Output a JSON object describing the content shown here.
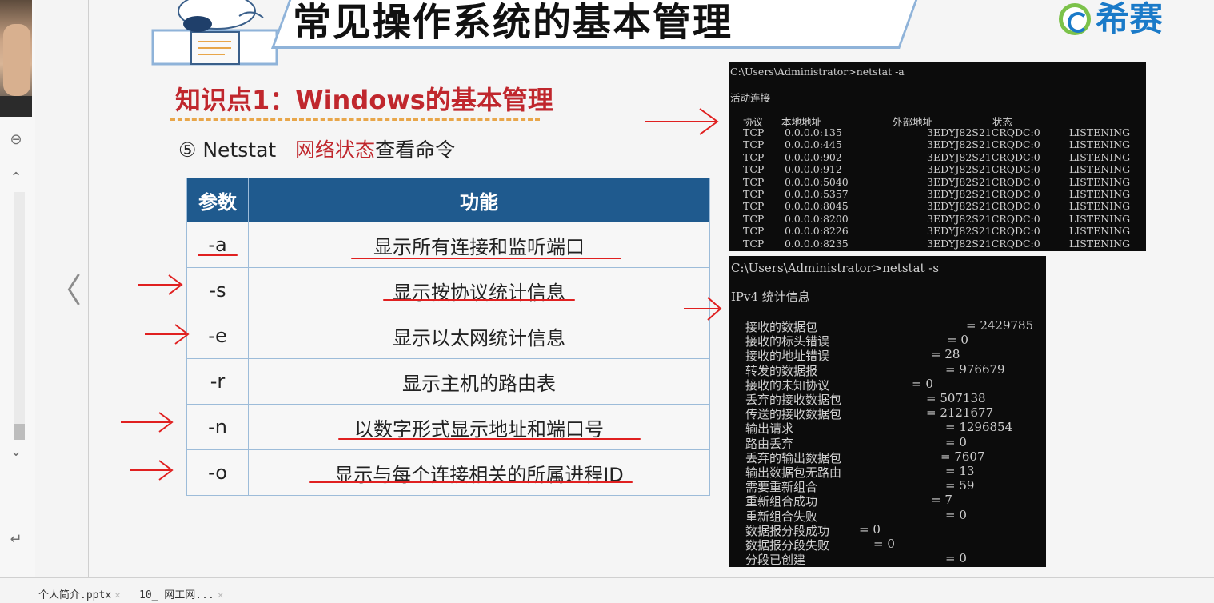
{
  "slide": {
    "title": "常见操作系统的基本管理",
    "brand": {
      "name": "希赛"
    },
    "topic_heading": "知识点1：Windows的基本管理",
    "subtitle": {
      "prefix": "⑤ Netstat",
      "highlight": "网络状态",
      "suffix": "查看命令"
    },
    "table": {
      "headers": [
        "参数",
        "功能"
      ],
      "rows": [
        {
          "param": "-a",
          "function": "显示所有连接和监听端口"
        },
        {
          "param": "-s",
          "function": "显示按协议统计信息"
        },
        {
          "param": "-e",
          "function": "显示以太网统计信息"
        },
        {
          "param": "-r",
          "function": "显示主机的路由表"
        },
        {
          "param": "-n",
          "function": "以数字形式显示地址和端口号"
        },
        {
          "param": "-o",
          "function": "显示与每个连接相关的所属进程ID"
        }
      ]
    }
  },
  "terminal_a": {
    "prompt": "C:\\Users\\Administrator>netstat -a",
    "section": "活动连接",
    "columns": [
      "协议",
      "本地地址",
      "外部地址",
      "状态"
    ],
    "rows": [
      [
        "TCP",
        "0.0.0.0:135",
        "3EDYJ82S21CRQDC:0",
        "LISTENING"
      ],
      [
        "TCP",
        "0.0.0.0:445",
        "3EDYJ82S21CRQDC:0",
        "LISTENING"
      ],
      [
        "TCP",
        "0.0.0.0:902",
        "3EDYJ82S21CRQDC:0",
        "LISTENING"
      ],
      [
        "TCP",
        "0.0.0.0:912",
        "3EDYJ82S21CRQDC:0",
        "LISTENING"
      ],
      [
        "TCP",
        "0.0.0.0:5040",
        "3EDYJ82S21CRQDC:0",
        "LISTENING"
      ],
      [
        "TCP",
        "0.0.0.0:5357",
        "3EDYJ82S21CRQDC:0",
        "LISTENING"
      ],
      [
        "TCP",
        "0.0.0.0:8045",
        "3EDYJ82S21CRQDC:0",
        "LISTENING"
      ],
      [
        "TCP",
        "0.0.0.0:8200",
        "3EDYJ82S21CRQDC:0",
        "LISTENING"
      ],
      [
        "TCP",
        "0.0.0.0:8226",
        "3EDYJ82S21CRQDC:0",
        "LISTENING"
      ],
      [
        "TCP",
        "0.0.0.0:8235",
        "3EDYJ82S21CRQDC:0",
        "LISTENING"
      ]
    ]
  },
  "terminal_s": {
    "prompt": "C:\\Users\\Administrator>netstat -s",
    "section": "IPv4 统计信息",
    "stats": [
      [
        "接收的数据包",
        "= 2429785"
      ],
      [
        "接收的标头错误",
        "= 0"
      ],
      [
        "接收的地址错误",
        "= 28"
      ],
      [
        "转发的数据报",
        "= 976679"
      ],
      [
        "接收的未知协议",
        "= 0"
      ],
      [
        "丢弃的接收数据包",
        "= 507138"
      ],
      [
        "传送的接收数据包",
        "= 2121677"
      ],
      [
        "输出请求",
        "= 1296854"
      ],
      [
        "路由丢弃",
        "= 0"
      ],
      [
        "丢弃的输出数据包",
        "= 7607"
      ],
      [
        "输出数据包无路由",
        "= 13"
      ],
      [
        "需要重新组合",
        "= 59"
      ],
      [
        "重新组合成功",
        "= 7"
      ],
      [
        "重新组合失败",
        "= 0"
      ],
      [
        "数据报分段成功",
        "= 0"
      ],
      [
        "数据报分段失败",
        "= 0"
      ],
      [
        "分段已创建",
        "= 0"
      ]
    ]
  },
  "bottom_tabs": [
    {
      "label": "个人简介.pptx"
    },
    {
      "label": "10_ 网工网..."
    }
  ],
  "icons": {
    "collapse": "minus-circle-icon",
    "scroll_up": "chevron-up-icon",
    "scroll_down": "chevron-down-icon",
    "enter": "enter-icon",
    "prev": "chevron-left-icon"
  },
  "colors": {
    "accent_red": "#c0272d",
    "table_header": "#1f5a8e",
    "brand_blue": "#1a7ac8",
    "brand_green": "#7cc24a",
    "annotation": "#e02020"
  }
}
